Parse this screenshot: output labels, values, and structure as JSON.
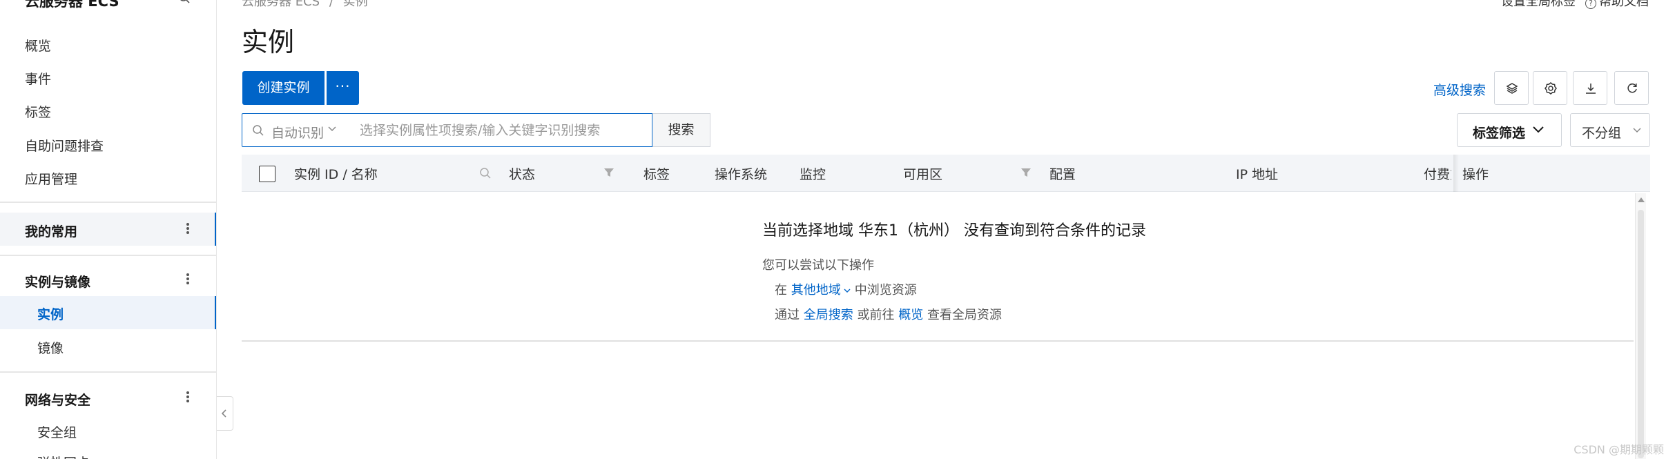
{
  "sidebar": {
    "title": "云服务器 ECS",
    "items": [
      {
        "label": "概览"
      },
      {
        "label": "事件"
      },
      {
        "label": "标签"
      },
      {
        "label": "自助问题排查"
      },
      {
        "label": "应用管理"
      }
    ],
    "pinned_group": "我的常用",
    "groups": [
      {
        "label": "实例与镜像",
        "items": [
          {
            "label": "实例"
          },
          {
            "label": "镜像"
          }
        ]
      },
      {
        "label": "网络与安全",
        "items": [
          {
            "label": "安全组"
          },
          {
            "label": "弹性网卡"
          }
        ]
      }
    ]
  },
  "header": {
    "breadcrumb": [
      "云服务器 ECS",
      "实例"
    ],
    "breadcrumb_sep": "/",
    "top_links": [
      "设置全局标签",
      "帮助文档"
    ],
    "title": "实例"
  },
  "toolbar": {
    "create_label": "创建实例",
    "more_label": "···",
    "advanced_search": "高级搜索",
    "icons": [
      "layers-icon",
      "gear-icon",
      "download-icon",
      "refresh-icon"
    ]
  },
  "search": {
    "mode_label": "自动识别",
    "placeholder": "选择实例属性项搜索/输入关键字识别搜索",
    "button_label": "搜索"
  },
  "filters": {
    "tag_filter": "标签筛选",
    "group_by": "不分组"
  },
  "table": {
    "columns": [
      "实例 ID / 名称",
      "状态",
      "标签",
      "操作系统",
      "监控",
      "可用区",
      "配置",
      "IP 地址",
      "付费方式",
      "操作"
    ]
  },
  "empty_state": {
    "title": "当前选择地域 华东1（杭州） 没有查询到符合条件的记录",
    "subtitle": "您可以尝试以下操作",
    "line1_prefix": "在",
    "line1_link": "其他地域",
    "line1_suffix": "中浏览资源",
    "line2_prefix": "通过",
    "line2_link1": "全局搜索",
    "line2_mid": "或前往",
    "line2_link2": "概览",
    "line2_suffix": "查看全局资源"
  },
  "watermark": "CSDN @期期颗颗",
  "colors": {
    "accent": "#0064c8",
    "header_bg": "#f3f5f8"
  }
}
